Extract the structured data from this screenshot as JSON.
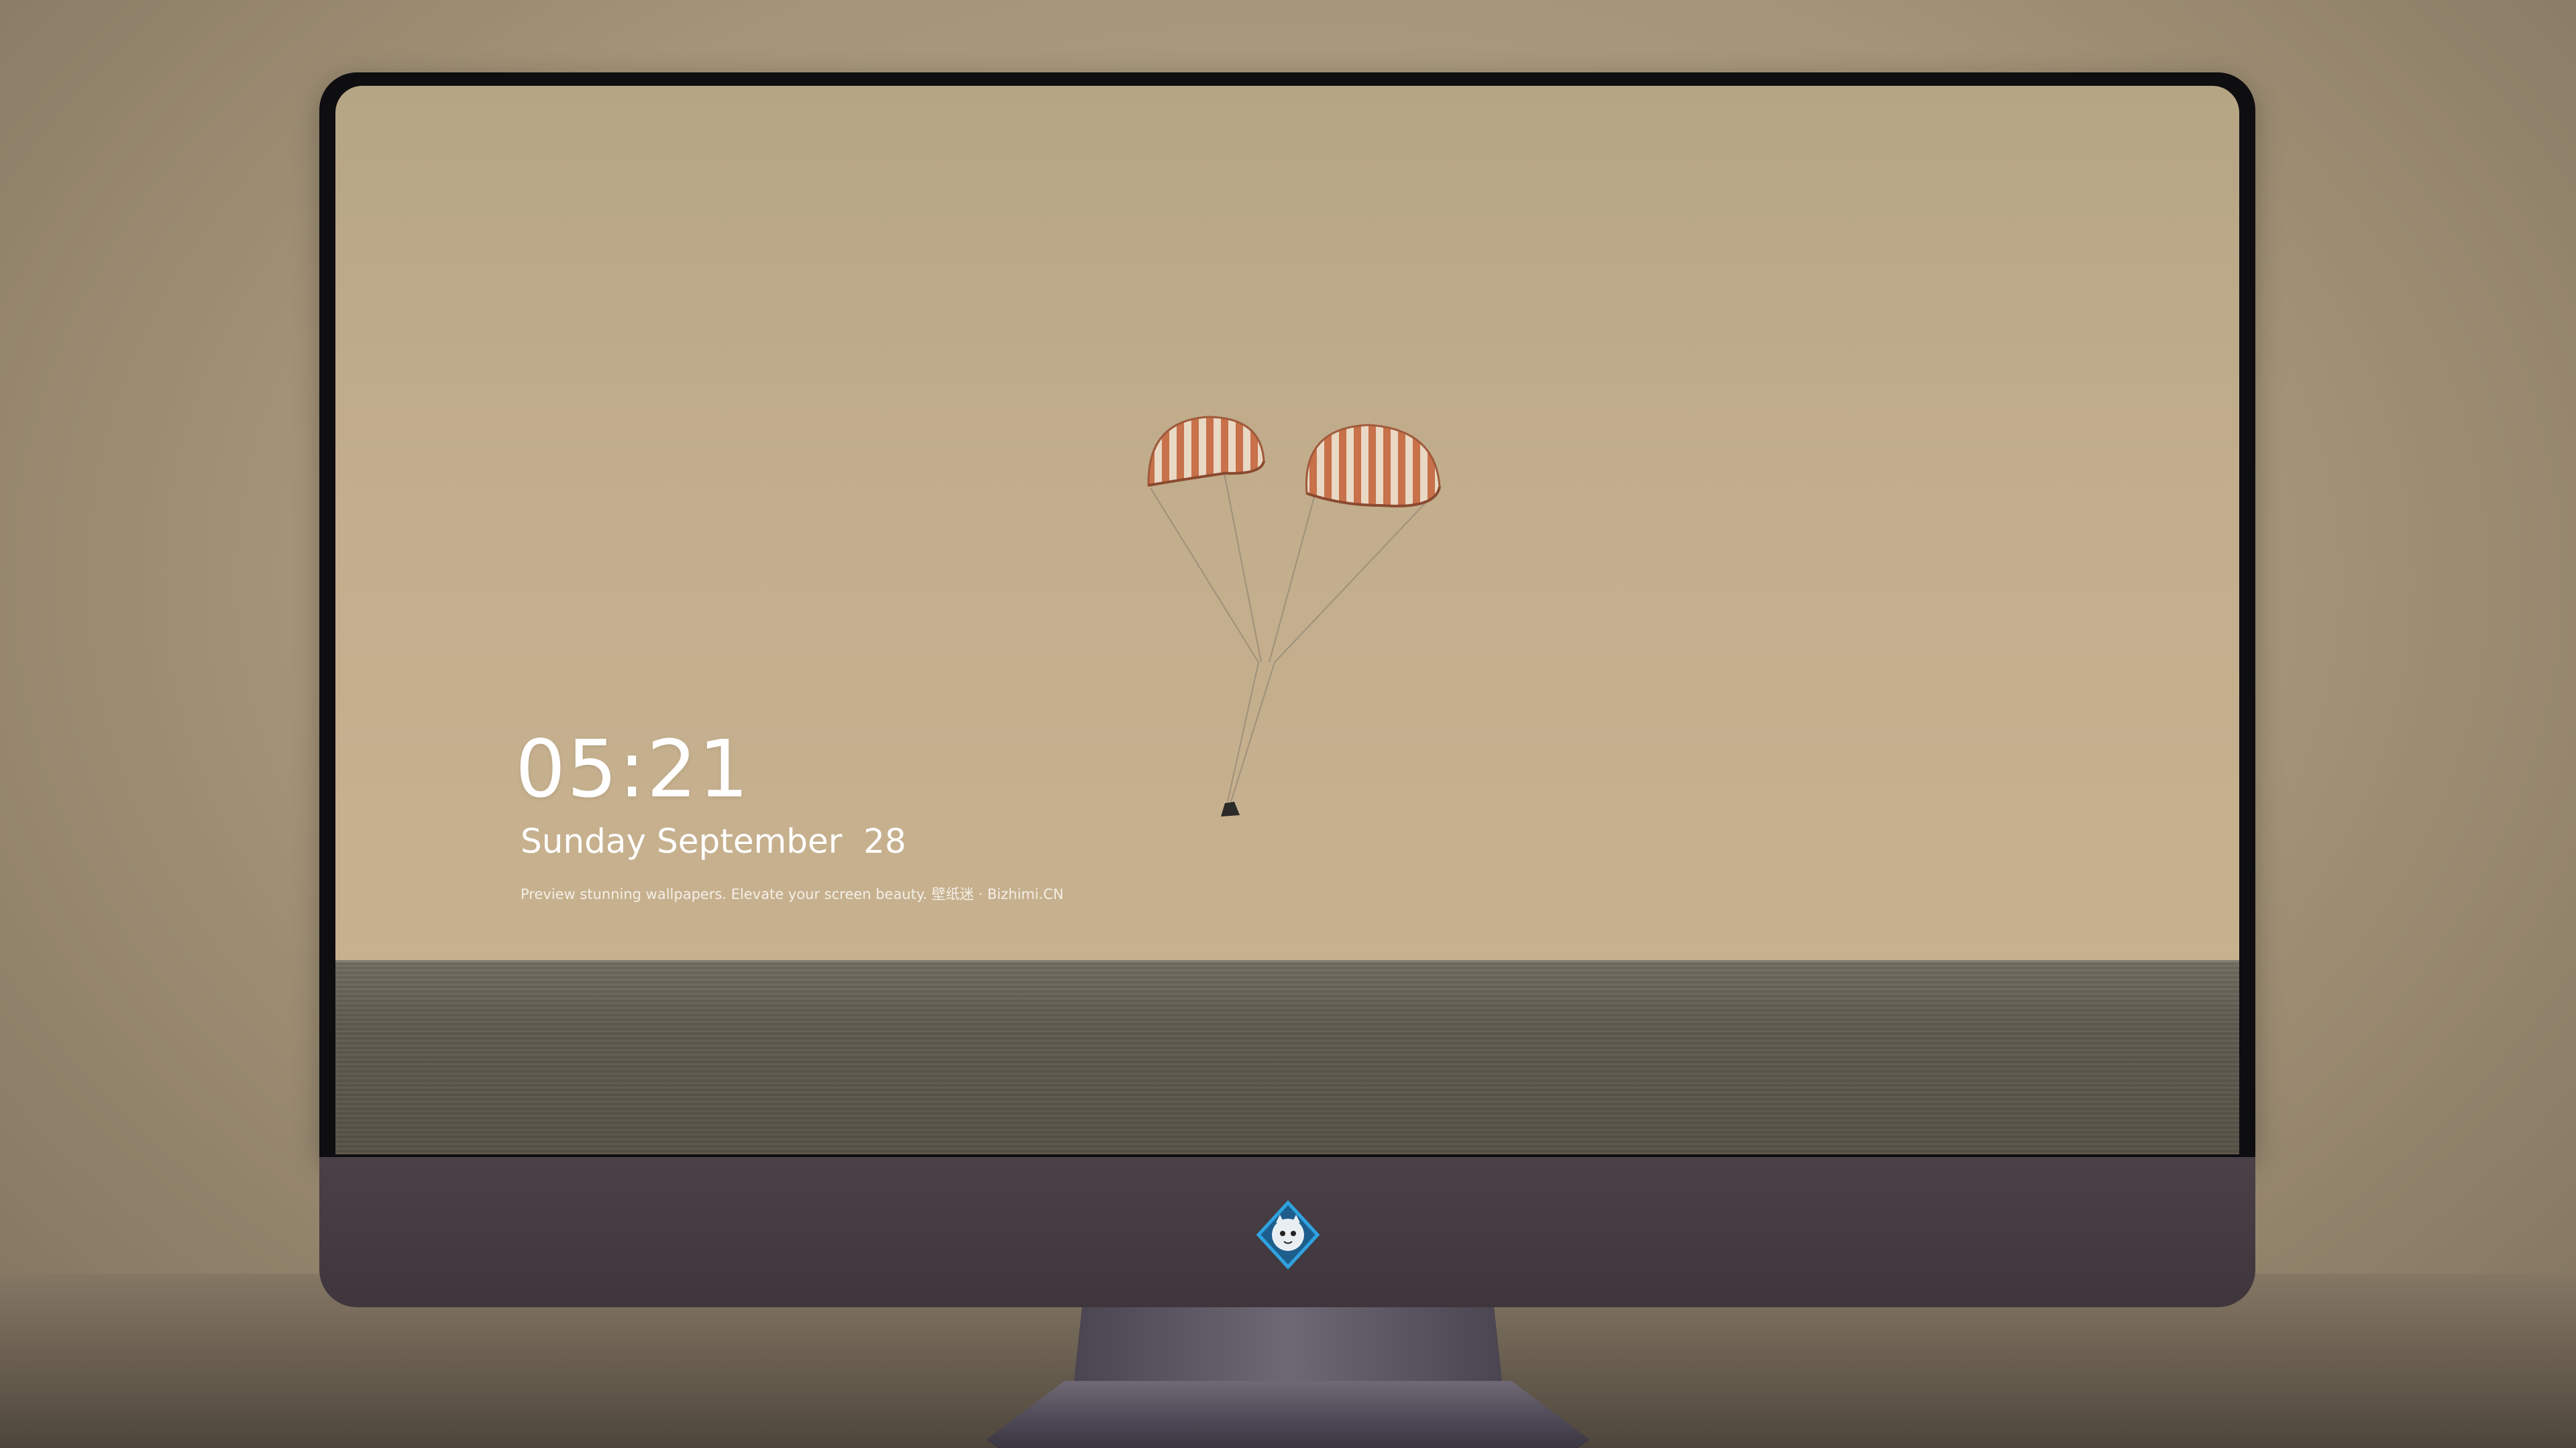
{
  "lock_screen": {
    "time": "05:21",
    "date": "Sunday September  28",
    "tagline": "Preview stunning wallpapers. Elevate your screen beauty. 壁纸迷 · Bizhimi.CN"
  },
  "dock": {
    "apps": [
      {
        "name": "messages-icon",
        "color": "#3ccf4e"
      },
      {
        "name": "weather-icon",
        "color": "#1e8df2"
      },
      {
        "name": "clock-icon",
        "color": "#1a1a1a"
      },
      {
        "name": "preview-icon",
        "color": "#f3c64a"
      },
      {
        "name": "clips-icon",
        "color": "#43c6e8"
      },
      {
        "name": "notes-icon",
        "color": "#fcd34d"
      },
      {
        "name": "photo-booth-icon",
        "color": "#e8e8e8"
      },
      {
        "name": "music-icon",
        "color": "#e64fd1"
      },
      {
        "name": "app-store-icon",
        "color": "#1f8cf0"
      },
      {
        "name": "camera-icon",
        "color": "#6b6b6b"
      }
    ]
  },
  "colors": {
    "sky": "#c1ad8c",
    "sea": "#615c52",
    "bezel": "#0e0d10",
    "chin": "#453b42"
  }
}
